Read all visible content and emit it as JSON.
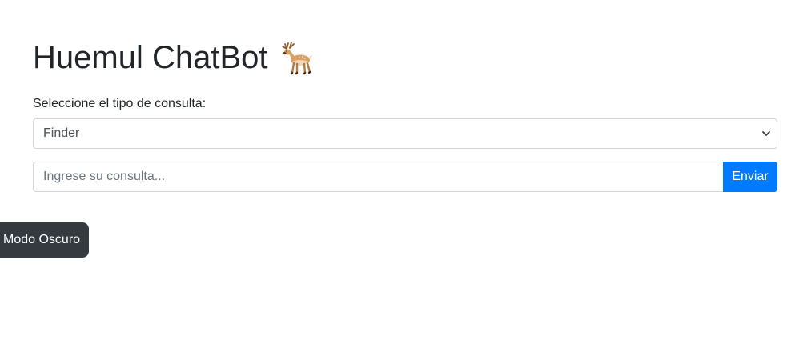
{
  "header": {
    "title": "Huemul ChatBot",
    "emoji_icon": "deer-icon"
  },
  "form": {
    "query_type_label": "Seleccione el tipo de consulta:",
    "query_type_selected": "Finder",
    "query_input_value": "",
    "query_input_placeholder": "Ingrese su consulta...",
    "submit_label": "Enviar"
  },
  "theme_toggle": {
    "label": "Modo Oscuro"
  },
  "colors": {
    "primary": "#007bff",
    "dark": "#343a40",
    "border": "#ced4da"
  }
}
